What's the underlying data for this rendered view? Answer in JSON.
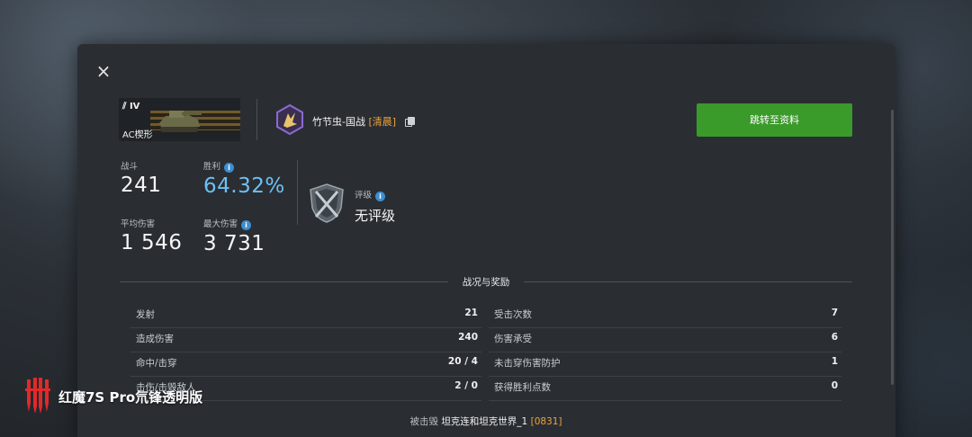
{
  "close_label": "×",
  "tank": {
    "tier": "IV",
    "name": "AC楔形"
  },
  "player": {
    "name": "竹节虫-国战",
    "clan": "[清晨]"
  },
  "profile_button": "跳转至资料",
  "stats": {
    "battles_label": "战斗",
    "battles_value": "241",
    "wins_label": "胜利",
    "wins_value": "64.32%",
    "avg_damage_label": "平均伤害",
    "avg_damage_value": "1 546",
    "max_damage_label": "最大伤害",
    "max_damage_value": "3 731"
  },
  "rating": {
    "label": "评级",
    "value": "无评级"
  },
  "section_title": "战况与奖励",
  "rows_left": [
    {
      "k": "发射",
      "v": "21"
    },
    {
      "k": "造成伤害",
      "v": "240"
    },
    {
      "k": "命中/击穿",
      "v": "20 / 4"
    },
    {
      "k": "击伤/击毁敌人",
      "v": "2 / 0"
    }
  ],
  "rows_right": [
    {
      "k": "受击次数",
      "v": "7"
    },
    {
      "k": "伤害承受",
      "v": "6"
    },
    {
      "k": "未击穿伤害防护",
      "v": "1"
    },
    {
      "k": "获得胜利点数",
      "v": "0"
    }
  ],
  "footer": {
    "prefix": "被击毁",
    "name": "坦克连和坦克世界_1",
    "tag": "[0831]"
  },
  "watermark": "红魔7S Pro氘锋透明版",
  "colors": {
    "accent_green": "#3a9a2a",
    "win_blue": "#6ec0f2",
    "clan_orange": "#f0a23a"
  }
}
